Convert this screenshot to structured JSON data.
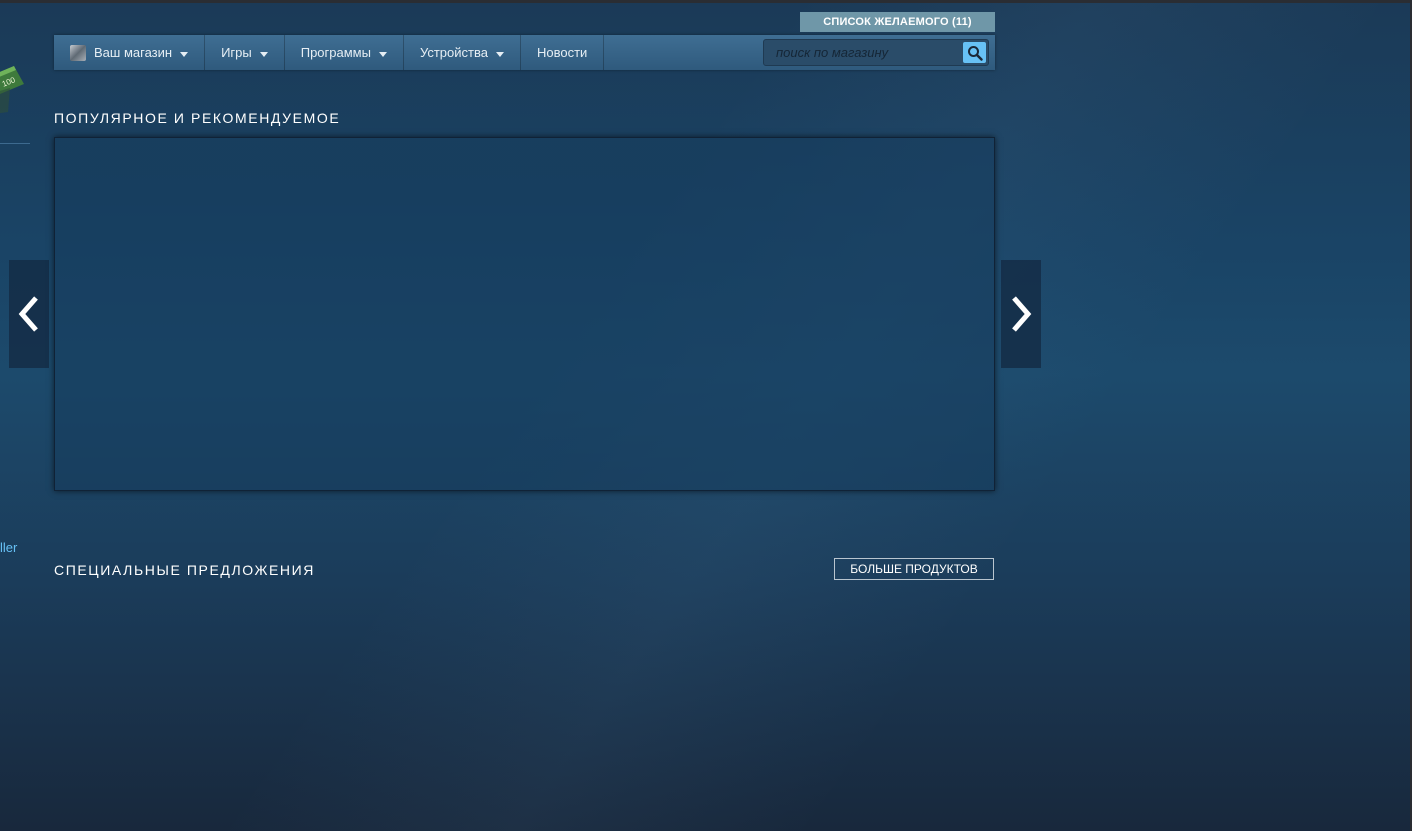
{
  "header": {
    "wishlist_label": "СПИСОК ЖЕЛАЕМОГО (11)"
  },
  "nav": {
    "items": [
      {
        "label": "Ваш магазин",
        "icon": "store-avatar-icon",
        "dropdown": true
      },
      {
        "label": "Игры",
        "dropdown": true
      },
      {
        "label": "Программы",
        "dropdown": true
      },
      {
        "label": "Устройства",
        "dropdown": true
      },
      {
        "label": "Новости",
        "dropdown": false
      }
    ],
    "search_placeholder": "поиск по магазину",
    "search_icon": "search-icon"
  },
  "featured": {
    "title": "ПОПУЛЯРНОЕ И РЕКОМЕНДУЕМОЕ",
    "prev_icon": "chevron-left-icon",
    "next_icon": "chevron-right-icon"
  },
  "specials": {
    "title": "СПЕЦИАЛЬНЫЕ ПРЕДЛОЖЕНИЯ",
    "more_label": "БОЛЬШЕ ПРОДУКТОВ"
  },
  "sidebar": {
    "badge_text": "100",
    "partial_link": "ller"
  },
  "colors": {
    "accent": "#67c1f5",
    "nav_bg": "#3f6e93",
    "wishlist_bg": "#6f97a8"
  }
}
